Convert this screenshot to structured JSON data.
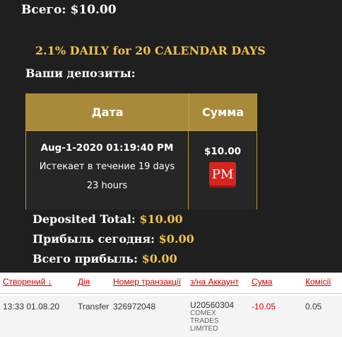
{
  "header": {
    "total": "Всего: $10.00"
  },
  "plan": {
    "title": "2.1% DAILY for 20 CALENDAR DAYS"
  },
  "deposits": {
    "heading": "Ваши депозиты:",
    "columns": {
      "date": "Дата",
      "amount": "Сумма"
    },
    "row": {
      "datetime": "Aug-1-2020 01:19:40 PM",
      "expires": "Истекает в течение 19 days",
      "hours": "23 hours",
      "amount": "$10.00",
      "processor_logo": "PM"
    }
  },
  "summary": {
    "deposited_label": "Deposited Total:",
    "deposited_value": "$10.00",
    "today_label": "Прибыль сегодня:",
    "today_value": "$0.00",
    "total_label": "Всего прибыль:",
    "total_value": "$0.00"
  },
  "transactions": {
    "headers": [
      "Створений ↓",
      "Дія",
      "Номер транзакції",
      "з/на Аккаунт",
      "Сума",
      "Комісії"
    ],
    "rows": [
      {
        "created": "13:33 01.08.20",
        "action": "Transfer",
        "number": "326972048",
        "account_id": "U20560304",
        "account_name_1": "COMEX",
        "account_name_2": "TRADES",
        "account_name_3": "LIMITED",
        "amount": "-10.05",
        "fee": "0.05"
      }
    ]
  },
  "colors": {
    "accent_gold": "#f0c24b",
    "header_gold": "#a88a3a",
    "link_red": "#cc0000",
    "negative_red": "#e00000"
  }
}
